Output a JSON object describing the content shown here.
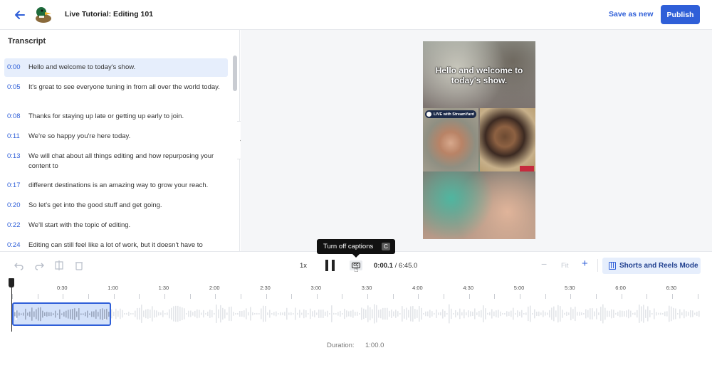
{
  "app": {
    "title": "Live Tutorial: Editing 101"
  },
  "header": {
    "save_as_new": "Save as new",
    "publish": "Publish",
    "back_icon": "arrow-left-icon",
    "logo_icon": "duck-logo-icon"
  },
  "transcript": {
    "heading": "Transcript",
    "lines": [
      {
        "time": "0:00",
        "text": "Hello and welcome to today's show."
      },
      {
        "time": "0:05",
        "text": "It's great to see everyone tuning in from all over the world today."
      },
      {
        "time": "0:08",
        "text": "Thanks for staying up late or getting up early to join."
      },
      {
        "time": "0:11",
        "text": "We're so happy you're here today."
      },
      {
        "time": "0:13",
        "text": "We will chat about all things editing and how repurposing your content to"
      },
      {
        "time": "0:17",
        "text": "different destinations is an amazing way to grow your reach."
      },
      {
        "time": "0:20",
        "text": "So let's get into the good stuff and get going."
      },
      {
        "time": "0:22",
        "text": "We'll start with the topic of editing."
      },
      {
        "time": "0:24",
        "text": "Editing can still feel like a lot of work, but it doesn't have to"
      }
    ]
  },
  "preview": {
    "caption": "Hello and welcome to today's show.",
    "live_badge": "LIVE with StreamYard"
  },
  "tooltip": {
    "text": "Turn off captions",
    "shortcut": "C"
  },
  "toolbar": {
    "speed": "1x",
    "current_time": "0:00.1",
    "separator": " / ",
    "total_time": "6:45.0",
    "zoom_fit": "Fit",
    "zoom_minus": "−",
    "zoom_plus": "+",
    "shorts_mode": "Shorts and Reels Mode",
    "icons": [
      "undo-icon",
      "redo-icon",
      "split-icon",
      "trash-icon",
      "pause-icon",
      "captions-icon",
      "film-icon"
    ]
  },
  "timeline": {
    "ticks": [
      "0:30",
      "1:00",
      "1:30",
      "2:00",
      "2:30",
      "3:00",
      "3:30",
      "4:00",
      "4:30",
      "5:00",
      "5:30",
      "6:00",
      "6:30"
    ],
    "duration_label": "Duration:",
    "duration_value": "1:00.0"
  },
  "colors": {
    "accent": "#2f5fd8",
    "active_row": "#e6eefc",
    "clip_fill": "#d4e2fa"
  }
}
